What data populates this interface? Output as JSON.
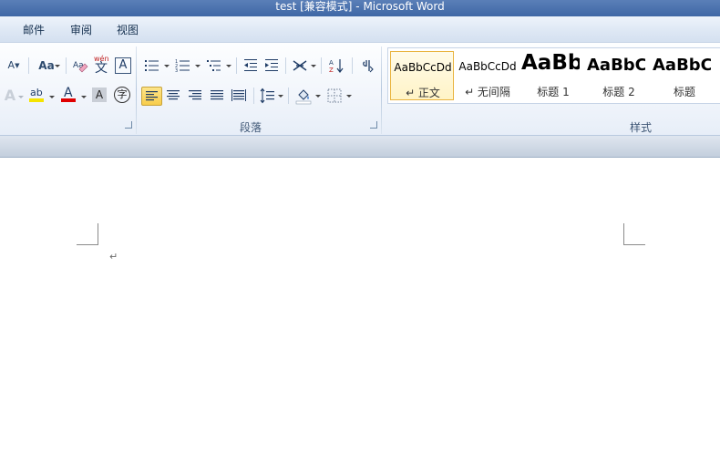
{
  "window": {
    "title": "test [兼容模式]  -  Microsoft Word"
  },
  "menu_tabs": [
    "邮件",
    "审阅",
    "视图"
  ],
  "font_group": {
    "grow_font_label": "A",
    "change_case_label": "Aa",
    "phonetic_label": "wén",
    "phonetic_char": "文",
    "char_border_label": "A",
    "text_effect_label": "A",
    "highlight_label": "ab",
    "font_color_label": "A",
    "shading_label": "A",
    "enclose_char_label": "字",
    "highlight_color": "#f5e400",
    "font_color": "#e00000"
  },
  "paragraph_group": {
    "label": "段落"
  },
  "styles_group": {
    "label": "样式",
    "items": [
      {
        "sample": "AaBbCcDd",
        "name": "↵ 正文",
        "active": true
      },
      {
        "sample": "AaBbCcDd",
        "name": "↵ 无间隔",
        "active": false
      },
      {
        "sample": "AaBb",
        "name": "标题 1",
        "active": false
      },
      {
        "sample": "AaBbC",
        "name": "标题 2",
        "active": false
      },
      {
        "sample": "AaBbC",
        "name": "标题",
        "active": false
      }
    ]
  },
  "document": {
    "paragraph_mark": "↵"
  }
}
